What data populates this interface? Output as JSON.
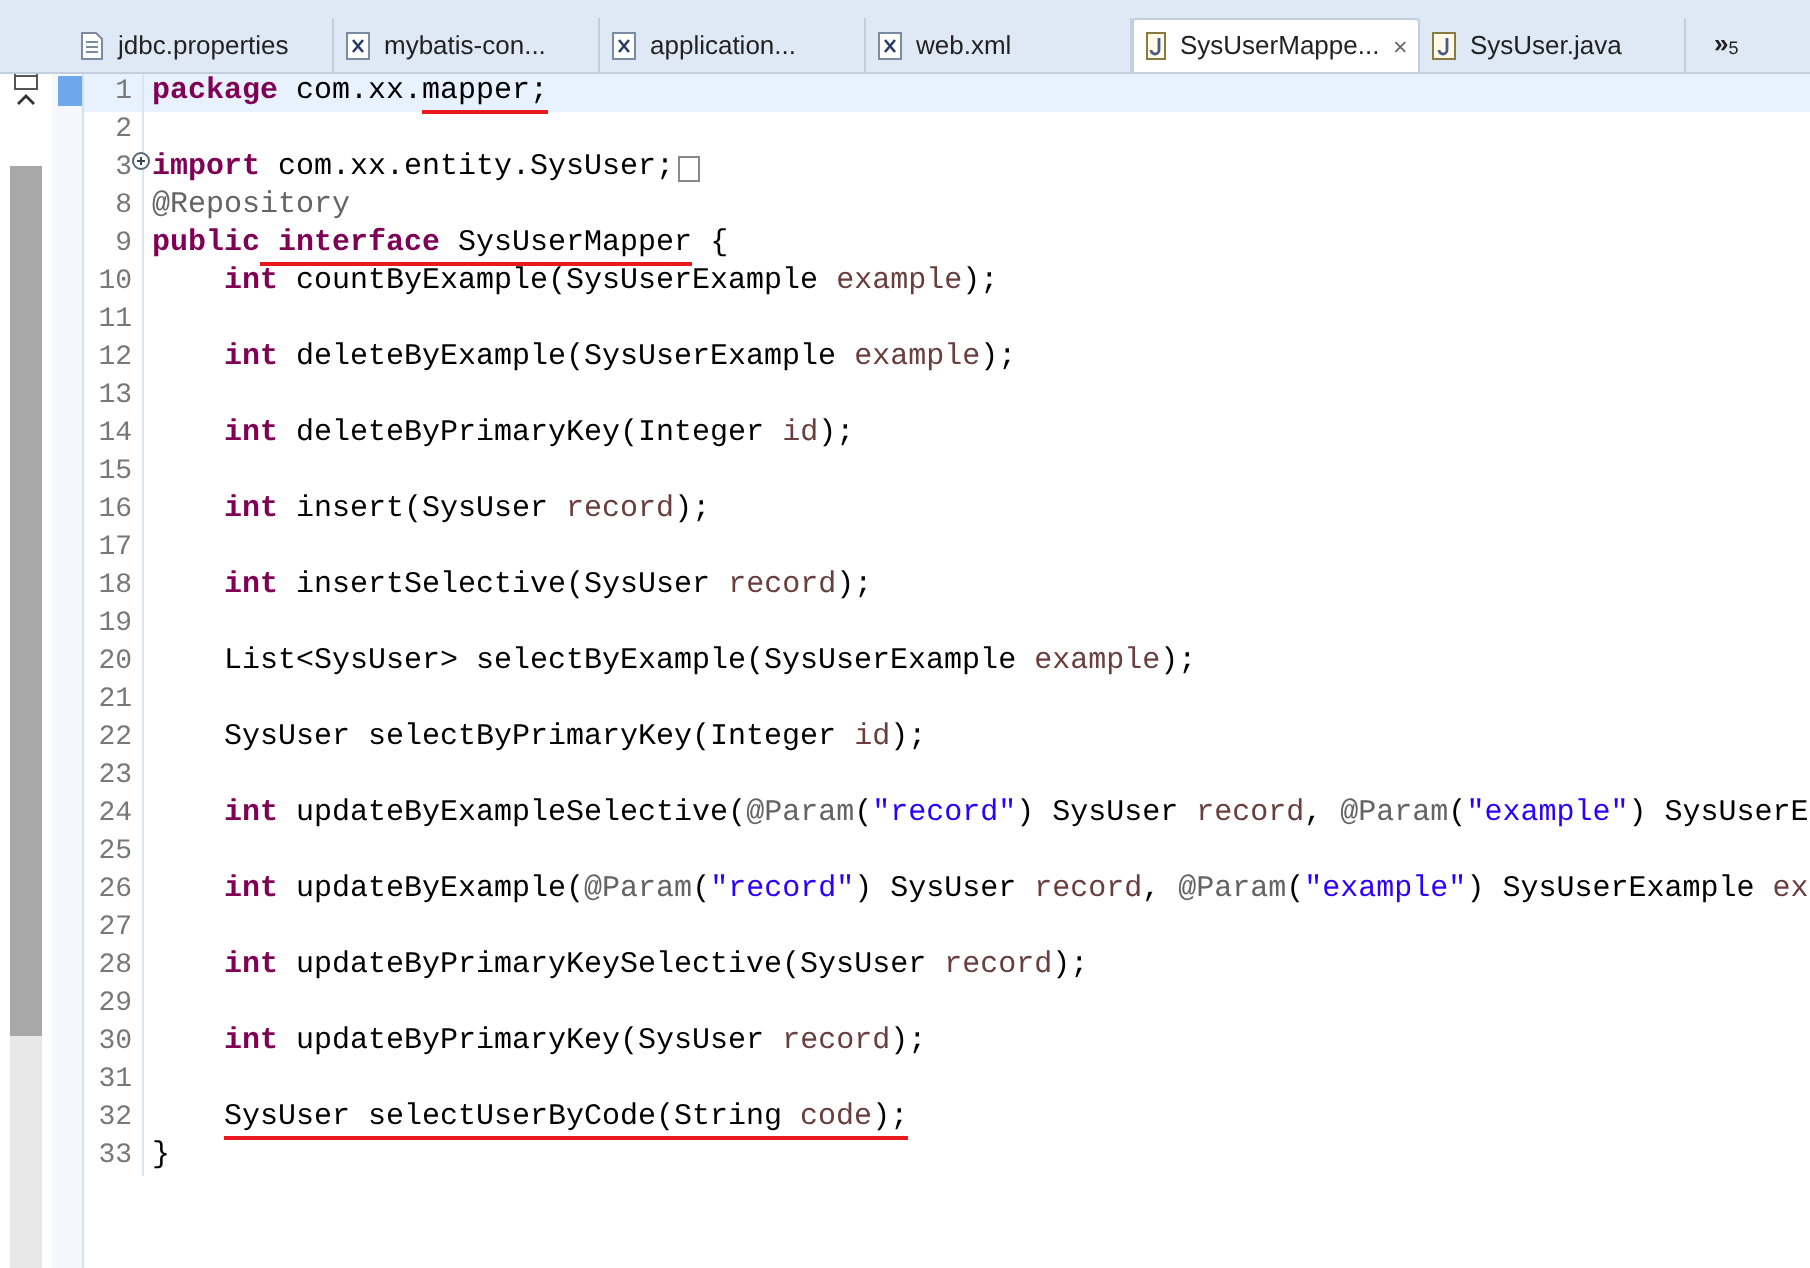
{
  "tabs": [
    {
      "label": "jdbc.properties",
      "kind": "file",
      "selected": false,
      "closable": false
    },
    {
      "label": "mybatis-con...",
      "kind": "xml",
      "selected": false,
      "closable": false
    },
    {
      "label": "application...",
      "kind": "xml",
      "selected": false,
      "closable": false
    },
    {
      "label": "web.xml",
      "kind": "xml",
      "selected": false,
      "closable": false
    },
    {
      "label": "SysUserMappe...",
      "kind": "java",
      "selected": true,
      "closable": true
    },
    {
      "label": "SysUser.java",
      "kind": "java",
      "selected": false,
      "closable": false
    }
  ],
  "overflow": {
    "glyph": "»",
    "count": "5"
  },
  "lines": [
    {
      "number": "1",
      "highlighted": true,
      "indented": false,
      "tokens": [
        {
          "kind": "keyword",
          "text": "package"
        },
        {
          "kind": "plain",
          "text": " com.xx."
        },
        {
          "kind": "plain",
          "text": "mapper;",
          "underline": true
        }
      ]
    },
    {
      "number": "2",
      "highlighted": false
    },
    {
      "number": "3",
      "highlighted": false,
      "indented": false,
      "folded": true,
      "tokens": [
        {
          "kind": "keyword",
          "text": "import"
        },
        {
          "kind": "plain",
          "text": " com.xx.entity.SysUser;"
        }
      ]
    },
    {
      "number": "8",
      "highlighted": false,
      "indented": false,
      "tokens": [
        {
          "kind": "annotation",
          "text": "@Repository"
        }
      ]
    },
    {
      "number": "9",
      "highlighted": false,
      "indented": false,
      "tokens": [
        {
          "kind": "keyword",
          "text": "public"
        },
        {
          "kind": "keyword",
          "text": " interface",
          "underline": true
        },
        {
          "kind": "plain",
          "text": " SysUserMapper",
          "underline": true
        },
        {
          "kind": "plain",
          "text": " {"
        }
      ]
    },
    {
      "number": "10",
      "highlighted": false,
      "indented": true,
      "tokens": [
        {
          "kind": "keyword",
          "text": "int"
        },
        {
          "kind": "plain",
          "text": " countByExample(SysUserExample "
        },
        {
          "kind": "param",
          "text": "example"
        },
        {
          "kind": "plain",
          "text": ");"
        }
      ]
    },
    {
      "number": "11",
      "highlighted": false
    },
    {
      "number": "12",
      "highlighted": false,
      "indented": true,
      "tokens": [
        {
          "kind": "keyword",
          "text": "int"
        },
        {
          "kind": "plain",
          "text": " deleteByExample(SysUserExample "
        },
        {
          "kind": "param",
          "text": "example"
        },
        {
          "kind": "plain",
          "text": ");"
        }
      ]
    },
    {
      "number": "13",
      "highlighted": false
    },
    {
      "number": "14",
      "highlighted": false,
      "indented": true,
      "tokens": [
        {
          "kind": "keyword",
          "text": "int"
        },
        {
          "kind": "plain",
          "text": " deleteByPrimaryKey(Integer "
        },
        {
          "kind": "param",
          "text": "id"
        },
        {
          "kind": "plain",
          "text": ");"
        }
      ]
    },
    {
      "number": "15",
      "highlighted": false
    },
    {
      "number": "16",
      "highlighted": false,
      "indented": true,
      "tokens": [
        {
          "kind": "keyword",
          "text": "int"
        },
        {
          "kind": "plain",
          "text": " insert(SysUser "
        },
        {
          "kind": "param",
          "text": "record"
        },
        {
          "kind": "plain",
          "text": ");"
        }
      ]
    },
    {
      "number": "17",
      "highlighted": false
    },
    {
      "number": "18",
      "highlighted": false,
      "indented": true,
      "tokens": [
        {
          "kind": "keyword",
          "text": "int"
        },
        {
          "kind": "plain",
          "text": " insertSelective(SysUser "
        },
        {
          "kind": "param",
          "text": "record"
        },
        {
          "kind": "plain",
          "text": ");"
        }
      ]
    },
    {
      "number": "19",
      "highlighted": false
    },
    {
      "number": "20",
      "highlighted": false,
      "indented": true,
      "tokens": [
        {
          "kind": "plain",
          "text": "List<SysUser> selectByExample(SysUserExample "
        },
        {
          "kind": "param",
          "text": "example"
        },
        {
          "kind": "plain",
          "text": ");"
        }
      ]
    },
    {
      "number": "21",
      "highlighted": false
    },
    {
      "number": "22",
      "highlighted": false,
      "indented": true,
      "tokens": [
        {
          "kind": "plain",
          "text": "SysUser selectByPrimaryKey(Integer "
        },
        {
          "kind": "param",
          "text": "id"
        },
        {
          "kind": "plain",
          "text": ");"
        }
      ]
    },
    {
      "number": "23",
      "highlighted": false
    },
    {
      "number": "24",
      "highlighted": false,
      "indented": true,
      "tokens": [
        {
          "kind": "keyword",
          "text": "int"
        },
        {
          "kind": "plain",
          "text": " updateByExampleSelective("
        },
        {
          "kind": "annotation",
          "text": "@Param"
        },
        {
          "kind": "plain",
          "text": "("
        },
        {
          "kind": "string",
          "text": "\"record\""
        },
        {
          "kind": "plain",
          "text": ") SysUser "
        },
        {
          "kind": "param",
          "text": "record"
        },
        {
          "kind": "plain",
          "text": ", "
        },
        {
          "kind": "annotation",
          "text": "@Param"
        },
        {
          "kind": "plain",
          "text": "("
        },
        {
          "kind": "string",
          "text": "\"example\""
        },
        {
          "kind": "plain",
          "text": ") SysUserE"
        }
      ]
    },
    {
      "number": "25",
      "highlighted": false
    },
    {
      "number": "26",
      "highlighted": false,
      "indented": true,
      "tokens": [
        {
          "kind": "keyword",
          "text": "int"
        },
        {
          "kind": "plain",
          "text": " updateByExample("
        },
        {
          "kind": "annotation",
          "text": "@Param"
        },
        {
          "kind": "plain",
          "text": "("
        },
        {
          "kind": "string",
          "text": "\"record\""
        },
        {
          "kind": "plain",
          "text": ") SysUser "
        },
        {
          "kind": "param",
          "text": "record"
        },
        {
          "kind": "plain",
          "text": ", "
        },
        {
          "kind": "annotation",
          "text": "@Param"
        },
        {
          "kind": "plain",
          "text": "("
        },
        {
          "kind": "string",
          "text": "\"example\""
        },
        {
          "kind": "plain",
          "text": ") SysUserExample "
        },
        {
          "kind": "param",
          "text": "ex"
        }
      ]
    },
    {
      "number": "27",
      "highlighted": false
    },
    {
      "number": "28",
      "highlighted": false,
      "indented": true,
      "tokens": [
        {
          "kind": "keyword",
          "text": "int"
        },
        {
          "kind": "plain",
          "text": " updateByPrimaryKeySelective(SysUser "
        },
        {
          "kind": "param",
          "text": "record"
        },
        {
          "kind": "plain",
          "text": ");"
        }
      ]
    },
    {
      "number": "29",
      "highlighted": false
    },
    {
      "number": "30",
      "highlighted": false,
      "indented": true,
      "tokens": [
        {
          "kind": "keyword",
          "text": "int"
        },
        {
          "kind": "plain",
          "text": " updateByPrimaryKey(SysUser "
        },
        {
          "kind": "param",
          "text": "record"
        },
        {
          "kind": "plain",
          "text": ");"
        }
      ]
    },
    {
      "number": "31",
      "highlighted": false
    },
    {
      "number": "32",
      "highlighted": false,
      "indented": true,
      "tokens": [
        {
          "kind": "plain",
          "text": "SysUser selectUserByCode(String ",
          "underline": true
        },
        {
          "kind": "param",
          "text": "code",
          "underline": true
        },
        {
          "kind": "plain",
          "text": ");",
          "underline": true
        }
      ]
    },
    {
      "number": "33",
      "highlighted": false,
      "indented": false,
      "tokens": [
        {
          "kind": "plain",
          "text": "}"
        }
      ]
    }
  ]
}
